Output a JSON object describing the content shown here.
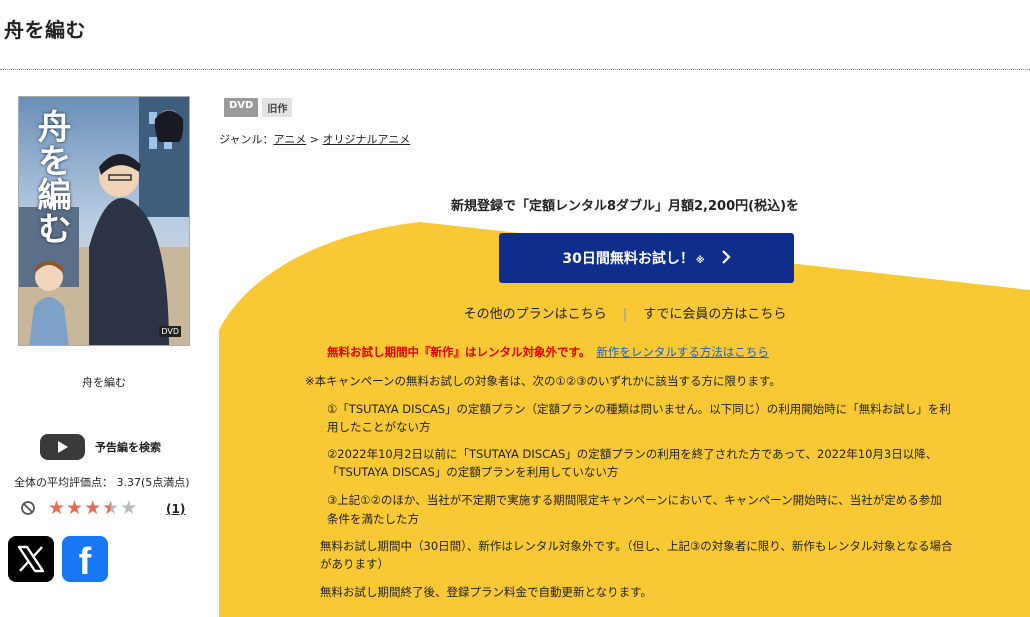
{
  "page": {
    "title": "舟を編む"
  },
  "product": {
    "cover_title": "舟を編む",
    "cover_tag": "DVD",
    "caption": "舟を編む",
    "badges": [
      "DVD",
      "旧作"
    ]
  },
  "trailer": {
    "label": "予告編を検索"
  },
  "rating": {
    "label": "全体の平均評価点： 3.37(5点満点)",
    "value": 3.37,
    "max": 5,
    "count": "(1)"
  },
  "genre": {
    "prefix": "ジャンル：",
    "items": [
      "アニメ",
      "オリジナルアニメ"
    ],
    "sep": ">"
  },
  "promo": {
    "headline": "新規登録で「定額レンタル8ダブル」月額2,200円(税込)を",
    "cta_label": "30日間無料お試し！",
    "cta_note": "※",
    "other_plans": "その他のプランはこちら",
    "separator": "|",
    "member_link": "すでに会員の方はこちら"
  },
  "notes": {
    "warning": "無料お試し期間中『新作』はレンタル対象外です。",
    "warning_link": "新作をレンタルする方法はこちら",
    "campaign": "※本キャンペーンの無料お試しの対象者は、次の①②③のいずれかに該当する方に限ります。",
    "c1_l1": "①「TSUTAYA DISCAS」の定額プラン（定額プランの種類は問いません。以下同じ）の利用開始時に「無料お試し」を利",
    "c1_l2": "用したことがない方",
    "c2_l1": "②2022年10月2日以前に「TSUTAYA DISCAS」の定額プランの利用を終了された方であって、2022年10月3日以降、",
    "c2_l2": "「TSUTAYA DISCAS」の定額プランを利用していない方",
    "c3_l1": "③上記①②のほか、当社が不定期で実施する期間限定キャンペーンにおいて、キャンペーン開始時に、当社が定める参加",
    "c3_l2": "条件を満たした方",
    "trial_l1": "無料お試し期間中（30日間）、新作はレンタル対象外です。（但し、上記③の対象者に限り、新作もレンタル対象となる場合",
    "trial_l2": "があります）",
    "renew": "無料お試し期間終了後、登録プラン料金で自動更新となります。"
  },
  "colors": {
    "accent_blue": "#0f2d8a",
    "promo_yellow": "#f8c935",
    "star": "#e56b55",
    "warning_red": "#e00000"
  },
  "icons": [
    "play-icon",
    "no-entry-icon",
    "star-icon",
    "x-logo-icon",
    "facebook-logo-icon",
    "chevron-right-icon"
  ]
}
